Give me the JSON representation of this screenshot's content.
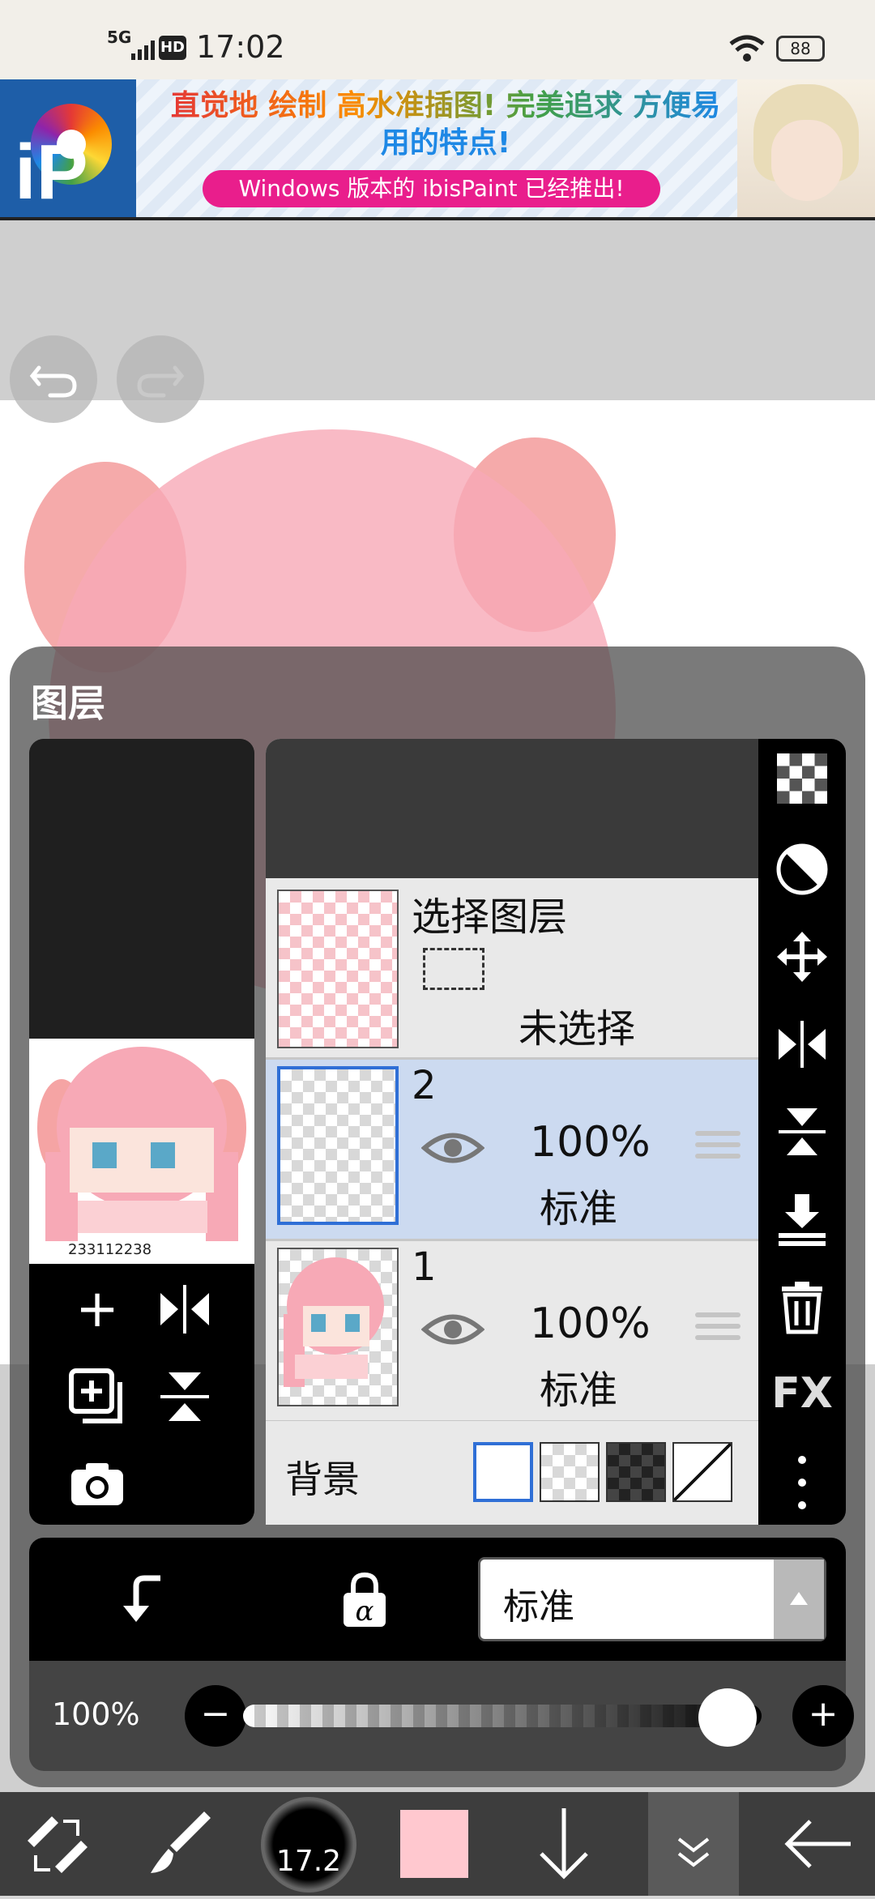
{
  "status": {
    "network": "5G",
    "hd_badge": "HD",
    "time": "17:02",
    "battery": "88"
  },
  "ad": {
    "logo_text": "iP",
    "headline_1": "直觉地 绘制 高水准插图! 完美追求 方便易",
    "headline_2": "用的特点!",
    "subline": "Windows 版本的 ibisPaint 已经推出!"
  },
  "canvas_nav": {
    "undo_icon": "undo-arrow",
    "redo_icon": "redo-arrow"
  },
  "layer_panel": {
    "title": "图层",
    "thumbnail_signature": "233112238",
    "select_layer": {
      "label": "选择图层",
      "status": "未选择"
    },
    "layers": [
      {
        "number": "2",
        "opacity": "100%",
        "blend_mode": "标准",
        "selected": true
      },
      {
        "number": "1",
        "opacity": "100%",
        "blend_mode": "标准",
        "selected": false
      }
    ],
    "background_label": "背景",
    "right_tools": [
      "transparency-icon",
      "mask-icon",
      "move-icon",
      "flip-horizontal-icon",
      "flip-vertical-icon",
      "merge-down-icon",
      "delete-icon",
      "fx-icon",
      "more-icon"
    ],
    "fx_label": "FX",
    "left_tools": [
      "add-layer-icon",
      "flip-h-icon",
      "duplicate-layer-icon",
      "flip-v-icon",
      "camera-icon"
    ],
    "blend_mode": "标准",
    "opacity_label": "100%",
    "opacity_value": 1.0
  },
  "toolbar": {
    "brush_size": "17.2",
    "color": "#ffc8cf"
  },
  "colors": {
    "selected_row": "#ccdaf0",
    "accent_blue": "#2f6fd6"
  }
}
